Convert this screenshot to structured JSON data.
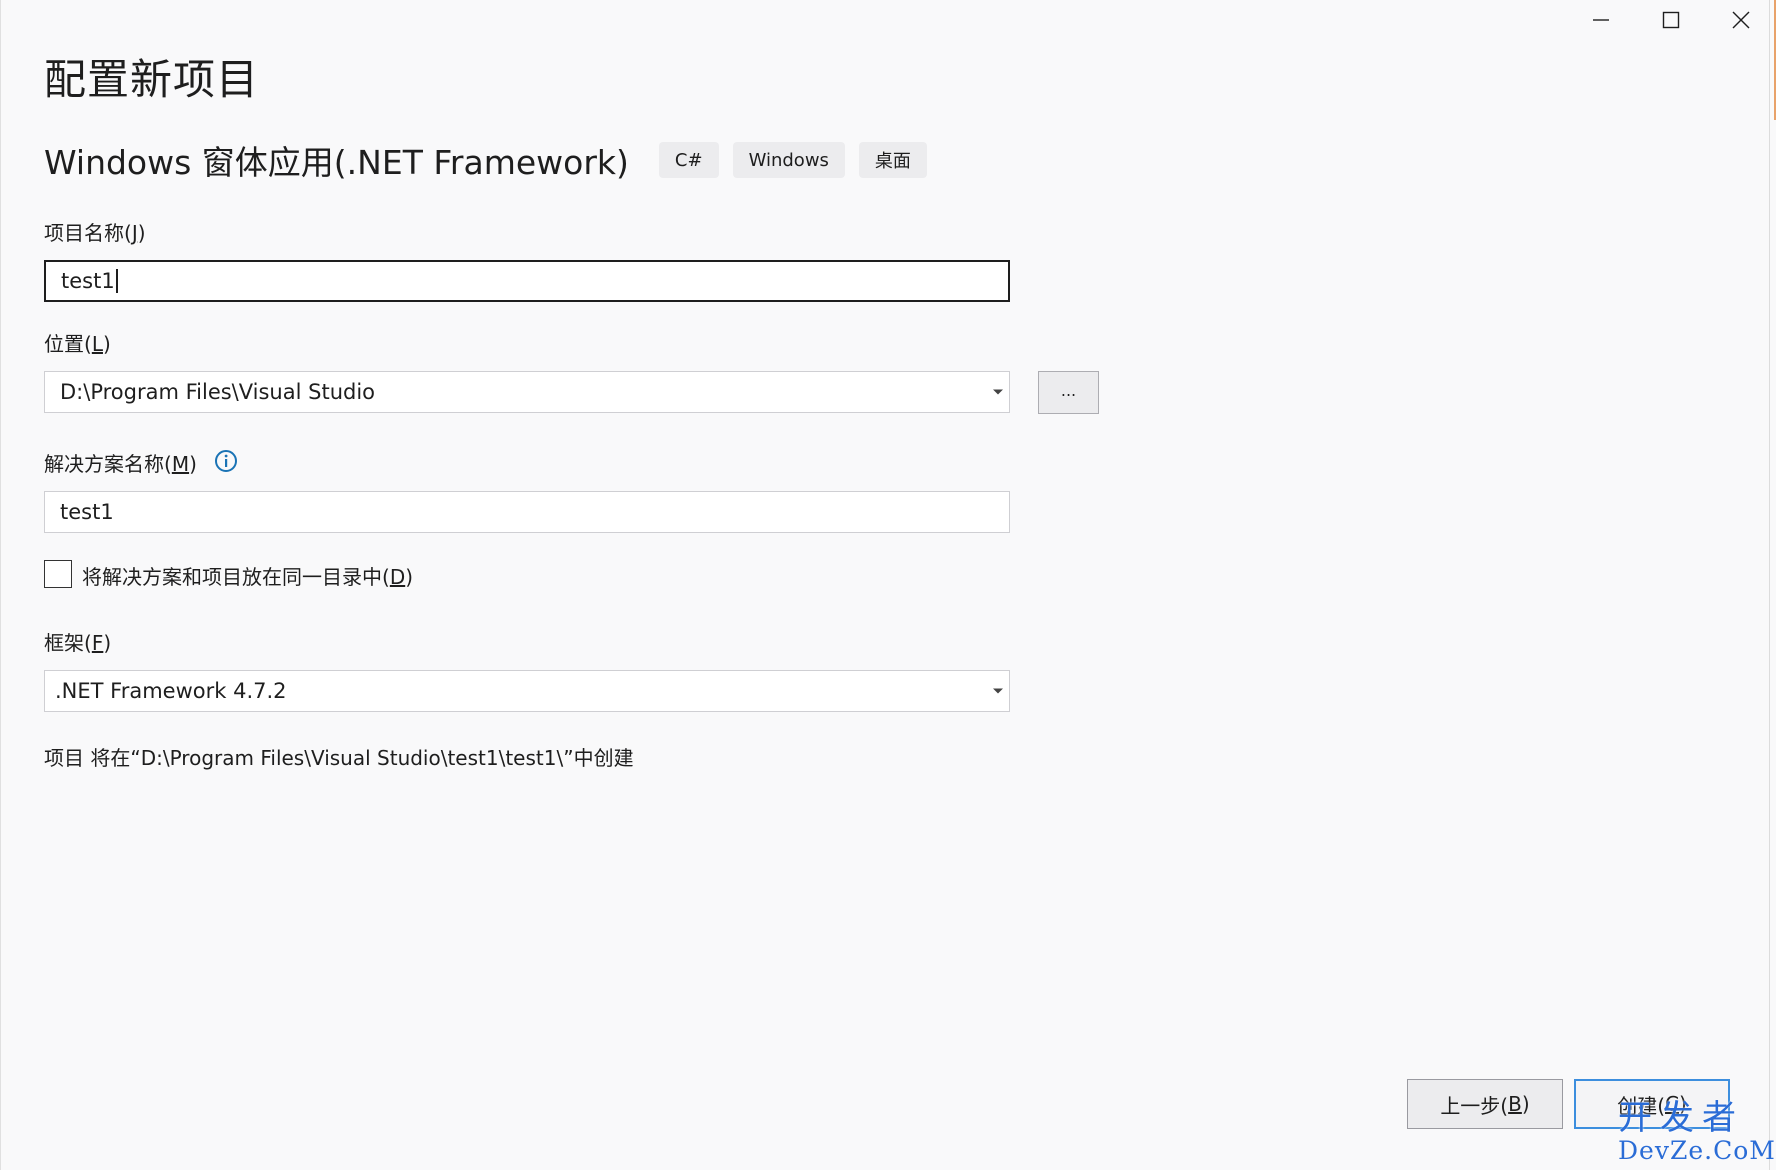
{
  "window": {
    "controls": [
      "minimize-icon",
      "maximize-icon",
      "close-icon"
    ]
  },
  "page_title": "配置新项目",
  "template": {
    "name": "Windows 窗体应用(.NET Framework)",
    "tags": [
      "C#",
      "Windows",
      "桌面"
    ]
  },
  "project_name": {
    "label": "项目名称(",
    "hotkey": "J",
    "label_end": ")",
    "value": "test1"
  },
  "location": {
    "label": "位置(",
    "hotkey": "L",
    "label_end": ")",
    "value": "D:\\Program Files\\Visual Studio",
    "browse_label": "..."
  },
  "solution_name": {
    "label": "解决方案名称(",
    "hotkey": "M",
    "label_end": ")",
    "value": "test1",
    "info_icon": "info-icon"
  },
  "same_dir": {
    "label": "将解决方案和项目放在同一目录中(",
    "hotkey": "D",
    "label_end": ")",
    "checked": false
  },
  "framework": {
    "label": "框架(",
    "hotkey": "F",
    "label_end": ")",
    "value": ".NET Framework 4.7.2"
  },
  "path_note": "项目 将在“D:\\Program Files\\Visual Studio\\test1\\test1\\”中创建",
  "buttons": {
    "back": {
      "label": "上一步(",
      "hotkey": "B",
      "label_end": ")"
    },
    "create": {
      "label": "创建(",
      "hotkey": "C",
      "label_end": ")"
    }
  },
  "watermark": {
    "top": "开发者",
    "bottom": "DevZe.CoM"
  },
  "colors": {
    "background": "#f9f9fa",
    "accent": "#3c8ede",
    "info": "#1a73b5",
    "watermark": "#2a6cd6"
  }
}
